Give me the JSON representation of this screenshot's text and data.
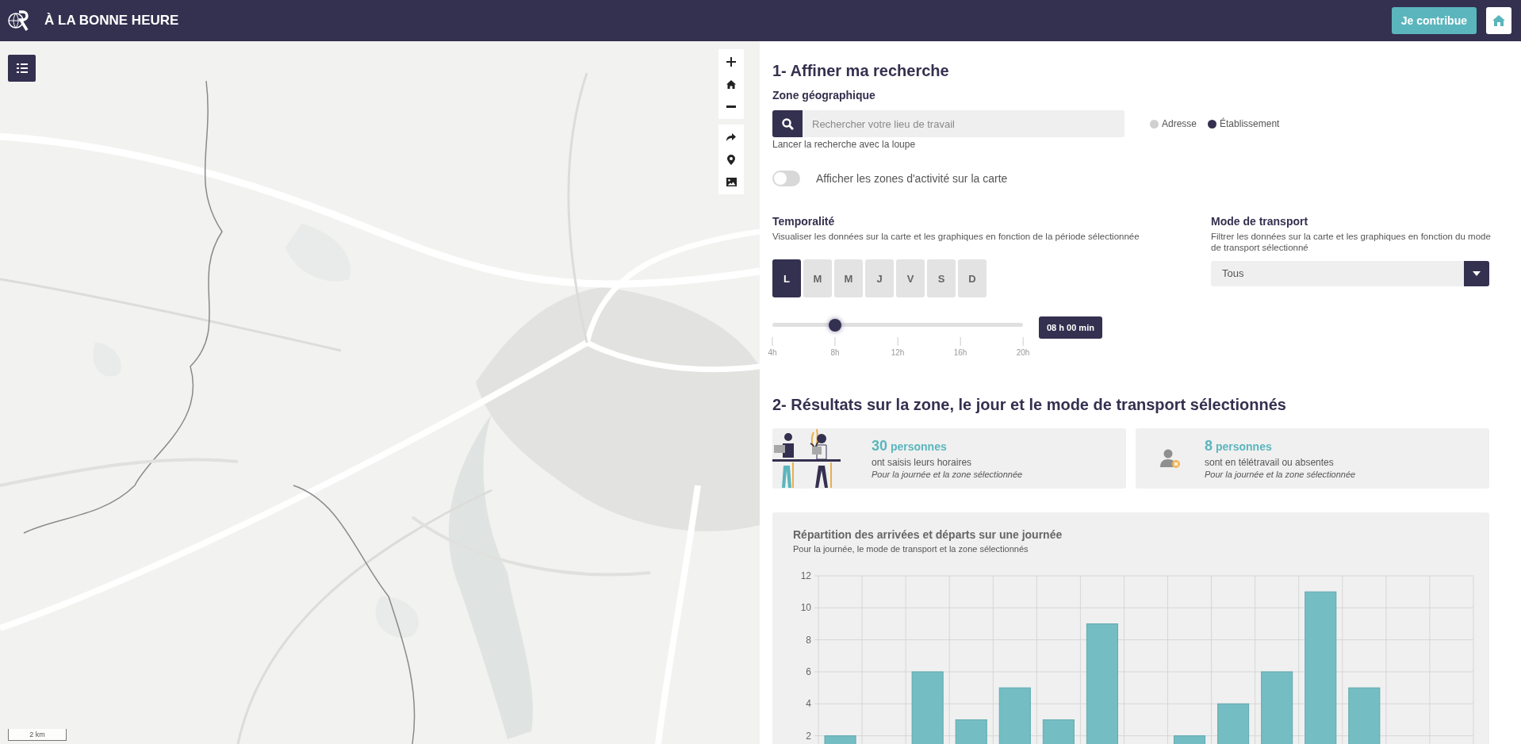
{
  "header": {
    "title": "À LA BONNE HEURE",
    "contribute_button": "Je contribue"
  },
  "map": {
    "kind": "picture",
    "scale": "2 km"
  },
  "search_section": {
    "title": "1- Affiner ma recherche",
    "zone_label": "Zone géographique",
    "search": {
      "placeholder": "Rechercher votre lieu de travail"
    },
    "hint": "Lancer la recherche avec la loupe",
    "radios": [
      {
        "label": "Adresse",
        "selected": false
      },
      {
        "label": "Établissement",
        "selected": true
      }
    ],
    "toggle": {
      "label": "Afficher les zones d'activité sur la carte",
      "on": false
    }
  },
  "temporality": {
    "title": "Temporalité",
    "description": "Visualiser les données sur la carte et les graphiques en fonction de la période sélectionnée",
    "days": [
      {
        "label": "L",
        "selected": true
      },
      {
        "label": "M",
        "selected": false
      },
      {
        "label": "M",
        "selected": false
      },
      {
        "label": "J",
        "selected": false
      },
      {
        "label": "V",
        "selected": false
      },
      {
        "label": "S",
        "selected": false
      },
      {
        "label": "D",
        "selected": false
      }
    ],
    "slider": {
      "level": 0.25,
      "ticks": [
        "4h",
        "8h",
        "12h",
        "16h",
        "20h"
      ]
    },
    "time_badge": "08 h 00 min"
  },
  "transport": {
    "title": "Mode de transport",
    "description": "Filtrer les données sur la carte et les graphiques en fonction du mode de transport sélectionné",
    "select": "Tous"
  },
  "results": {
    "title": "2- Résultats sur la zone, le jour et le mode de transport sélectionnés",
    "cards": [
      {
        "kind": "illustration",
        "count": "30",
        "unit": "personnes",
        "line": "ont saisis leurs horaires",
        "note": "Pour la journée et la zone sélectionnée"
      },
      {
        "kind": "person",
        "count": "8",
        "unit": "personnes",
        "line": "sont en télétravail ou absentes",
        "note": "Pour la journée et la zone sélectionnée"
      }
    ]
  },
  "chart": {
    "title": "Répartition des arrivées et départs sur une journée",
    "subtitle": "Pour la journée, le mode de transport et la zone sélectionnés",
    "chart_data": {
      "type": "bar",
      "grid": true,
      "ylim": [
        0,
        12
      ],
      "yticks": [
        2,
        4,
        6,
        8,
        10,
        12
      ],
      "series": [
        {
          "color": "#74bdc3",
          "values": [
            2,
            null,
            6,
            3,
            5,
            3,
            9,
            null,
            2,
            4,
            6,
            11,
            5,
            null,
            null
          ]
        }
      ]
    }
  }
}
